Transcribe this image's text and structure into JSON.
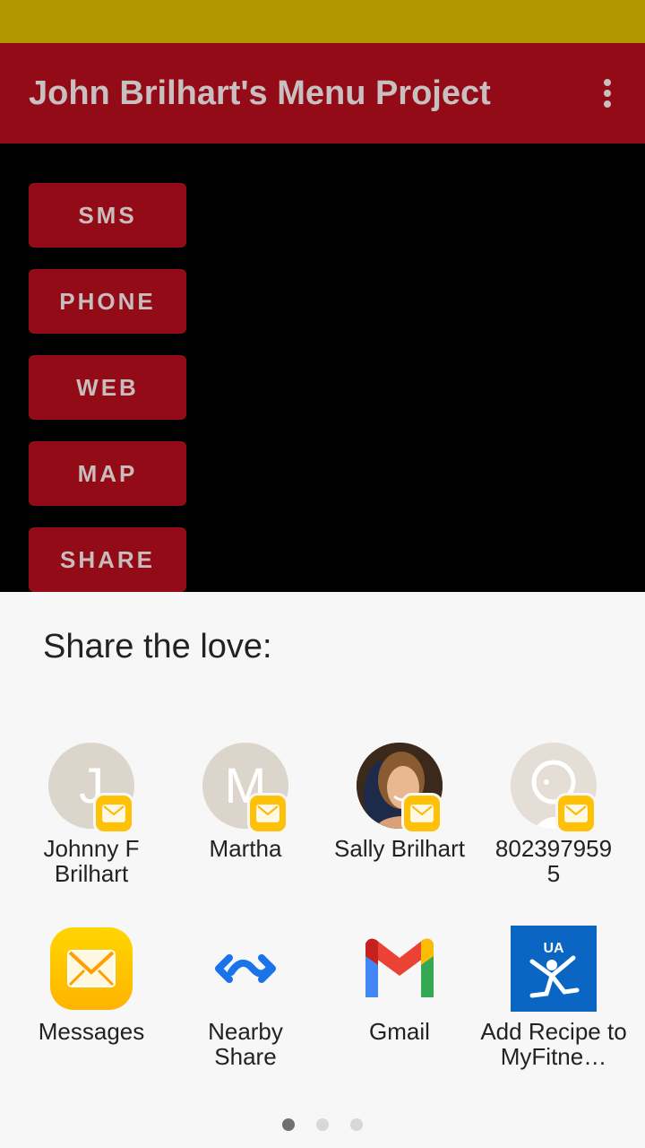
{
  "app": {
    "title": "John Brilhart's Menu Project"
  },
  "buttons": [
    {
      "label": "SMS"
    },
    {
      "label": "PHONE"
    },
    {
      "label": "WEB"
    },
    {
      "label": "MAP"
    },
    {
      "label": "SHARE"
    }
  ],
  "share_sheet": {
    "title": "Share the love:",
    "direct_targets": [
      {
        "name": "Johnny F Brilhart",
        "initial": "J",
        "badge": "messages-icon"
      },
      {
        "name": "Martha",
        "initial": "M",
        "badge": "messages-icon"
      },
      {
        "name": "Sally Brilhart",
        "initial": "",
        "badge": "messages-icon"
      },
      {
        "name": "8023979595",
        "initial": "",
        "badge": "messages-icon"
      }
    ],
    "apps": [
      {
        "name": "Messages",
        "icon": "messages-icon"
      },
      {
        "name": "Nearby Share",
        "icon": "nearby-share-icon"
      },
      {
        "name": "Gmail",
        "icon": "gmail-icon"
      },
      {
        "name": "Add Recipe to MyFitne…",
        "icon": "myfitnesspal-icon"
      }
    ],
    "page_indicator": {
      "pages": 3,
      "current": 1
    }
  },
  "colors": {
    "status_bar": "#b39700",
    "primary": "#930b16",
    "sheet_bg": "#f7f7f7",
    "messages_yellow": "#ffc107"
  }
}
